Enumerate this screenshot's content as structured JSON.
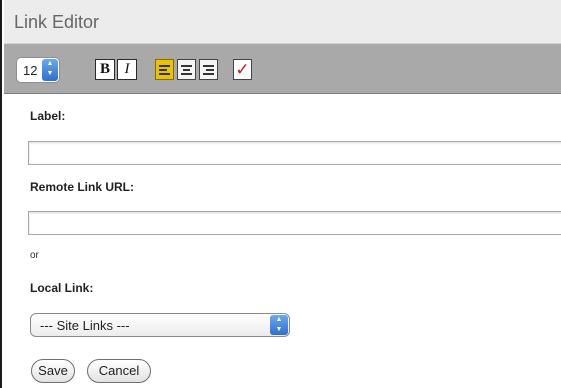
{
  "window": {
    "title": "Link Editor"
  },
  "toolbar": {
    "font_size": "12",
    "bold_label": "B",
    "italic_label": "I",
    "check_glyph": "✓"
  },
  "form": {
    "label_label": "Label:",
    "label_value": "",
    "remote_label": "Remote Link URL:",
    "remote_value": "",
    "or_text": "or",
    "local_label": "Local Link:",
    "local_selected": "--- Site Links ---"
  },
  "buttons": {
    "save": "Save",
    "cancel": "Cancel"
  },
  "colors": {
    "toolbar_bg": "#a9a9a9",
    "active_align": "#e9c200",
    "check": "#d01515",
    "spinner": "#2e6fce"
  },
  "icons": [
    "chevron-updown-icon",
    "align-left-icon",
    "align-center-icon",
    "align-right-icon",
    "checkmark-icon"
  ]
}
